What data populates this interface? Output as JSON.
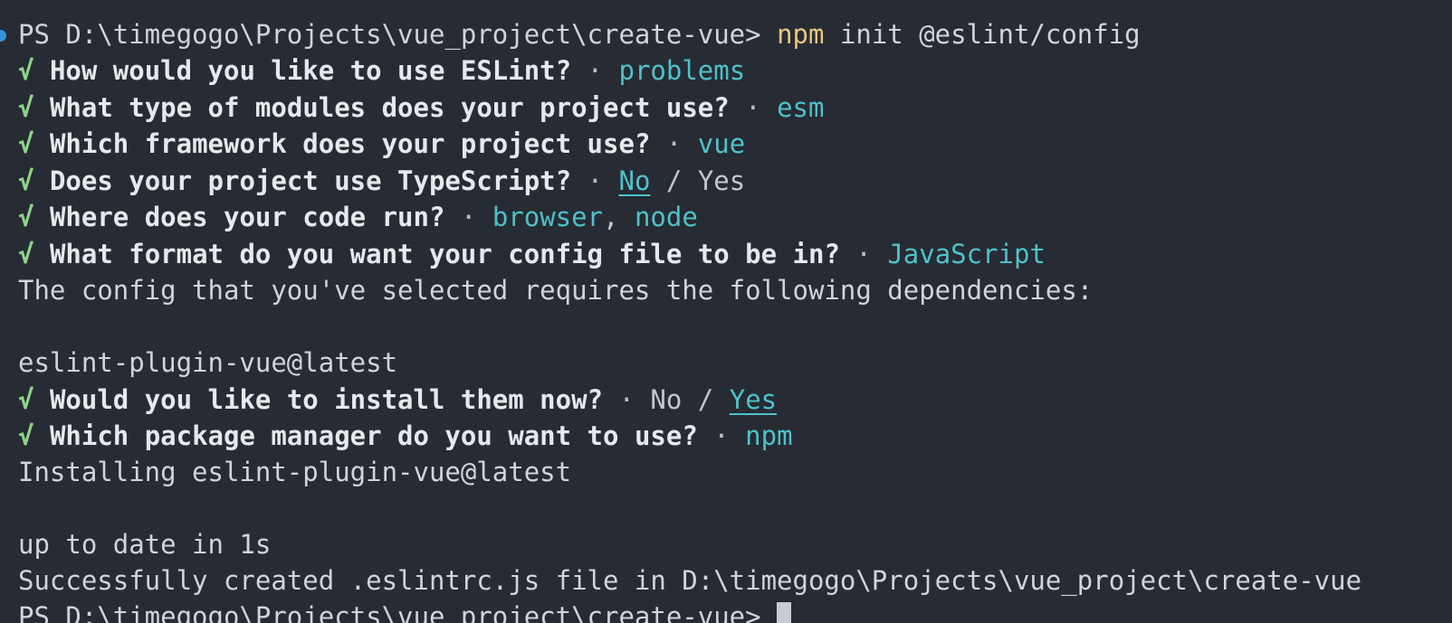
{
  "terminal": {
    "prompt": {
      "text": "PS D:\\timegogo\\Projects\\vue_project\\create-vue> ",
      "command": "npm",
      "args": " init @eslint/config"
    },
    "check_mark": "√",
    "separator": " · ",
    "questions": [
      {
        "question": "How would you like to use ESLint?",
        "answer": "problems"
      },
      {
        "question": "What type of modules does your project use?",
        "answer": "esm"
      },
      {
        "question": "Which framework does your project use?",
        "answer": "vue"
      },
      {
        "question": "Does your project use TypeScript?",
        "answer_selected": "No",
        "answer_slash": " / ",
        "answer_other": "Yes"
      },
      {
        "question": "Where does your code run?",
        "answer": "browser",
        "answer_comma": ", ",
        "answer_2": "node"
      },
      {
        "question": "What format do you want your config file to be in?",
        "answer": "JavaScript"
      }
    ],
    "deps_message": "The config that you've selected requires the following dependencies:",
    "dependency": "eslint-plugin-vue@latest",
    "install_question": {
      "question": "Would you like to install them now?",
      "answer_other": "No",
      "answer_slash": " / ",
      "answer_selected": "Yes"
    },
    "pkg_question": {
      "question": "Which package manager do you want to use?",
      "answer": "npm"
    },
    "installing": "Installing eslint-plugin-vue@latest",
    "up_to_date": "up to date in 1s",
    "success": "Successfully created .eslintrc.js file in D:\\timegogo\\Projects\\vue_project\\create-vue",
    "next_prompt": "PS D:\\timegogo\\Projects\\vue_project\\create-vue> "
  },
  "colors": {
    "background": "#272b33",
    "text": "#d1d4da",
    "check": "#8fd48a",
    "answer": "#4fc1c9",
    "command": "#e8c77a",
    "prompt_indicator": "#3794d6"
  },
  "icons": {
    "prompt_indicator": "circle-dot-icon",
    "cursor": "block-cursor"
  }
}
